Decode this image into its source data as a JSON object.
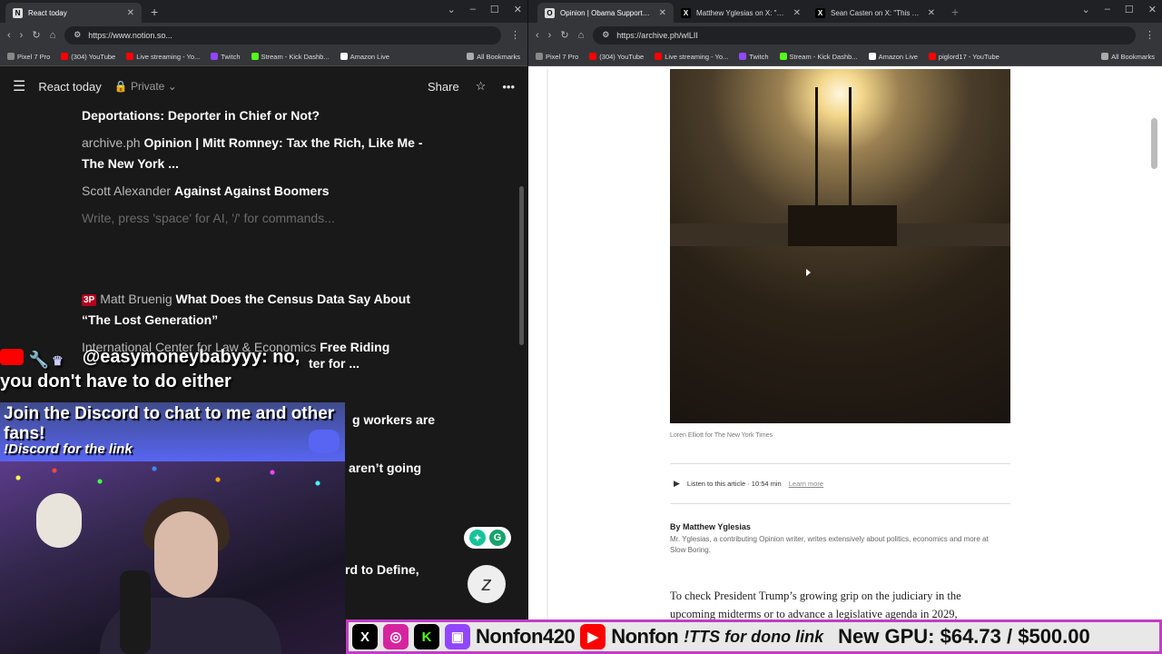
{
  "left_browser": {
    "tabs": [
      {
        "label": "React today",
        "active": true
      }
    ],
    "url": "https://www.notion.so...",
    "bookmarks": [
      {
        "label": "Pixel 7 Pro",
        "icon_color": "#888888"
      },
      {
        "label": "(304) YouTube",
        "icon_color": "#ff0000"
      },
      {
        "label": "Live streaming - Yo...",
        "icon_color": "#ff0000"
      },
      {
        "label": "Twitch",
        "icon_color": "#9146ff"
      },
      {
        "label": "Stream - Kick Dashb...",
        "icon_color": "#53fc18"
      },
      {
        "label": "Amazon Live",
        "icon_color": "#ffffff"
      }
    ],
    "all_bookmarks": "All Bookmarks"
  },
  "notion": {
    "page_title": "React today",
    "privacy": "Private",
    "share_label": "Share",
    "items": [
      {
        "source": "",
        "link": "Deportations: Deporter in Chief or Not?"
      },
      {
        "source": "archive.ph",
        "link": "Opinion | Mitt Romney: Tax the Rich, Like Me - The New York ..."
      },
      {
        "source": "Scott Alexander",
        "link": "Against Against Boomers"
      }
    ],
    "placeholder": "Write, press 'space' for AI, '/' for commands...",
    "items2": [
      {
        "badge": "3P",
        "source": "Matt Bruenig",
        "link": "What Does the Census Data Say About “The Lost Generation”"
      },
      {
        "source": "International Center for Law & Economics",
        "link": "Free Riding"
      }
    ],
    "partial": [
      "ter for ...",
      "g workers are",
      "aren’t going",
      "rd to Define,"
    ]
  },
  "stream_overlay": {
    "chat_user": "@easymoneybabyyy:",
    "chat_first": "no,",
    "chat_body": "you don't have to do either",
    "discord_title": "Join the Discord to chat to me and other fans!",
    "discord_cmd": "!Discord for the link"
  },
  "right_browser": {
    "tabs": [
      {
        "label": "Opinion | Obama Supported It",
        "active": true,
        "fav": "O"
      },
      {
        "label": "Matthew Yglesias on X: \"Okay,",
        "active": false,
        "fav": "X"
      },
      {
        "label": "Sean Casten on X: \"This Yglesia",
        "active": false,
        "fav": "X"
      }
    ],
    "url": "https://archive.ph/wlLII",
    "bookmarks": [
      {
        "label": "Pixel 7 Pro",
        "icon_color": "#888888"
      },
      {
        "label": "(304) YouTube",
        "icon_color": "#ff0000"
      },
      {
        "label": "Live streaming - Yo...",
        "icon_color": "#ff0000"
      },
      {
        "label": "Twitch",
        "icon_color": "#9146ff"
      },
      {
        "label": "Stream - Kick Dashb...",
        "icon_color": "#53fc18"
      },
      {
        "label": "Amazon Live",
        "icon_color": "#ffffff"
      },
      {
        "label": "piglord17 - YouTube",
        "icon_color": "#ff0000"
      }
    ],
    "all_bookmarks": "All Bookmarks"
  },
  "article": {
    "photo_credit": "Loren Elliott for The New York Times",
    "listen_text": "Listen to this article · 10:54 min",
    "learn_more": "Learn more",
    "byline": "By Matthew Yglesias",
    "author_desc": "Mr. Yglesias, a contributing Opinion writer, writes extensively about politics, economics and more at Slow Boring.",
    "body": "To check President Trump’s growing grip on the judiciary in the upcoming midterms or to advance a legislative agenda in 2029,"
  },
  "ticker": {
    "handle1": "Nonfon420",
    "handle2": "Nonfon",
    "tts": "!TTS for dono link",
    "goal": "New GPU: $64.73 / $500.00"
  }
}
